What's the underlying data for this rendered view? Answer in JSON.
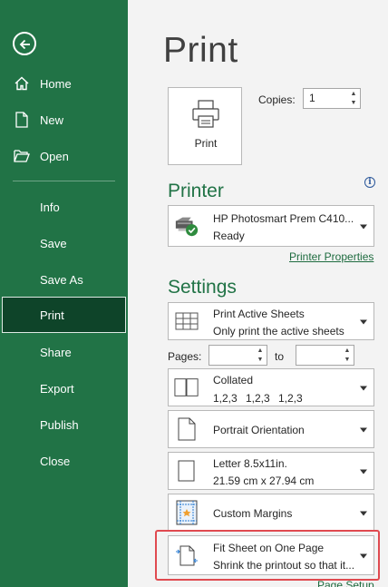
{
  "sidebar": {
    "items": [
      {
        "label": "Home"
      },
      {
        "label": "New"
      },
      {
        "label": "Open"
      },
      {
        "label": "Info"
      },
      {
        "label": "Save"
      },
      {
        "label": "Save As"
      },
      {
        "label": "Print"
      },
      {
        "label": "Share"
      },
      {
        "label": "Export"
      },
      {
        "label": "Publish"
      },
      {
        "label": "Close"
      }
    ]
  },
  "main": {
    "title": "Print",
    "print_button_label": "Print",
    "copies_label": "Copies:",
    "copies_value": "1",
    "printer": {
      "heading": "Printer",
      "name": "HP Photosmart Prem C410...",
      "status": "Ready",
      "properties_link": "Printer Properties"
    },
    "settings": {
      "heading": "Settings",
      "scope": {
        "title": "Print Active Sheets",
        "subtitle": "Only print the active sheets"
      },
      "pages_label": "Pages:",
      "pages_to_label": "to",
      "collation": {
        "title": "Collated",
        "subtitle_parts": [
          "1,2,3",
          "1,2,3",
          "1,2,3"
        ]
      },
      "orientation": {
        "title": "Portrait Orientation"
      },
      "paper": {
        "title": "Letter 8.5x11in.",
        "subtitle": "21.59 cm x 27.94 cm"
      },
      "margins": {
        "title": "Custom Margins"
      },
      "scaling": {
        "title": "Fit Sheet on One Page",
        "subtitle": "Shrink the printout so that it..."
      },
      "page_setup_link": "Page Setup"
    }
  },
  "colors": {
    "sidebar_bg": "#217346",
    "active_bg": "#0e4429",
    "accent_green": "#217346",
    "highlight": "#e04a50"
  }
}
